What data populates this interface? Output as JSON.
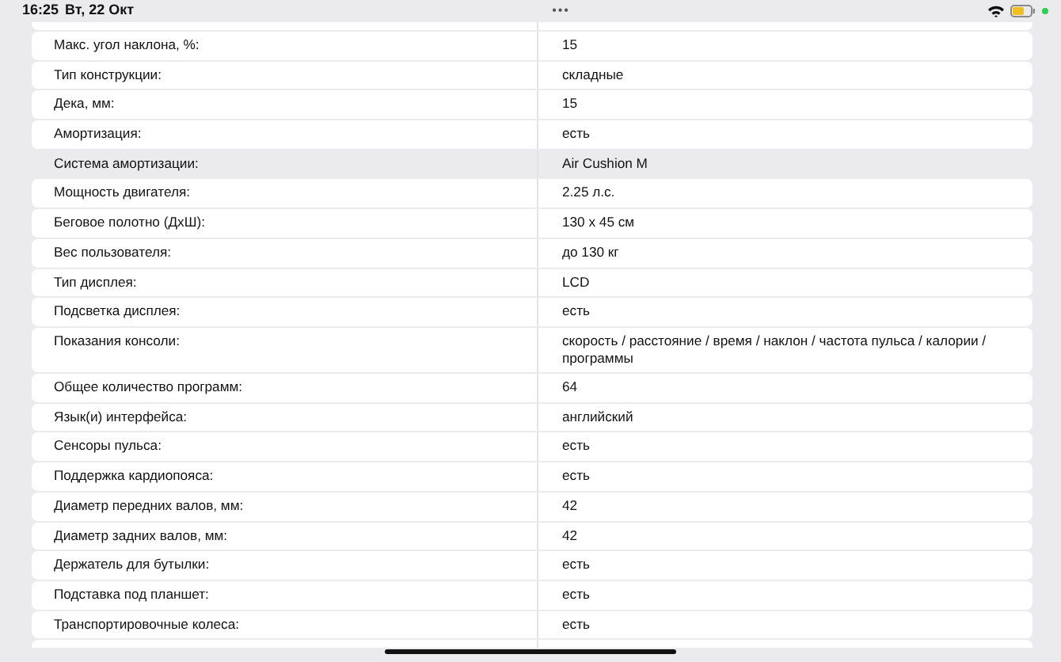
{
  "status_bar": {
    "time": "16:25",
    "date": "Вт, 22 Окт",
    "dots": "•••"
  },
  "specs": [
    {
      "label": "Макс. угол наклона, %:",
      "value": "15",
      "highlighted": false
    },
    {
      "label": "Тип конструкции:",
      "value": "складные",
      "highlighted": false
    },
    {
      "label": "Дека, мм:",
      "value": "15",
      "highlighted": false
    },
    {
      "label": "Амортизация:",
      "value": "есть",
      "highlighted": false
    },
    {
      "label": "Система амортизации:",
      "value": "Air Cushion M",
      "highlighted": true
    },
    {
      "label": "Мощность двигателя:",
      "value": "2.25 л.с.",
      "highlighted": false
    },
    {
      "label": "Беговое полотно (ДхШ):",
      "value": "130 х 45 см",
      "highlighted": false
    },
    {
      "label": "Вес пользователя:",
      "value": "до 130 кг",
      "highlighted": false
    },
    {
      "label": "Тип дисплея:",
      "value": "LCD",
      "highlighted": false
    },
    {
      "label": "Подсветка дисплея:",
      "value": "есть",
      "highlighted": false
    },
    {
      "label": "Показания консоли:",
      "value": "скорость / расстояние / время / наклон / частота пульса / калории / программы",
      "highlighted": false
    },
    {
      "label": "Общее количество программ:",
      "value": "64",
      "highlighted": false
    },
    {
      "label": "Язык(и) интерфейса:",
      "value": "английский",
      "highlighted": false
    },
    {
      "label": "Сенсоры пульса:",
      "value": "есть",
      "highlighted": false
    },
    {
      "label": "Поддержка кардиопояса:",
      "value": "есть",
      "highlighted": false
    },
    {
      "label": "Диаметр передних валов, мм:",
      "value": "42",
      "highlighted": false
    },
    {
      "label": "Диаметр задних валов, мм:",
      "value": "42",
      "highlighted": false
    },
    {
      "label": "Держатель для бутылки:",
      "value": "есть",
      "highlighted": false
    },
    {
      "label": "Подставка под планшет:",
      "value": "есть",
      "highlighted": false
    },
    {
      "label": "Транспортировочные колеса:",
      "value": "есть",
      "highlighted": false
    }
  ]
}
